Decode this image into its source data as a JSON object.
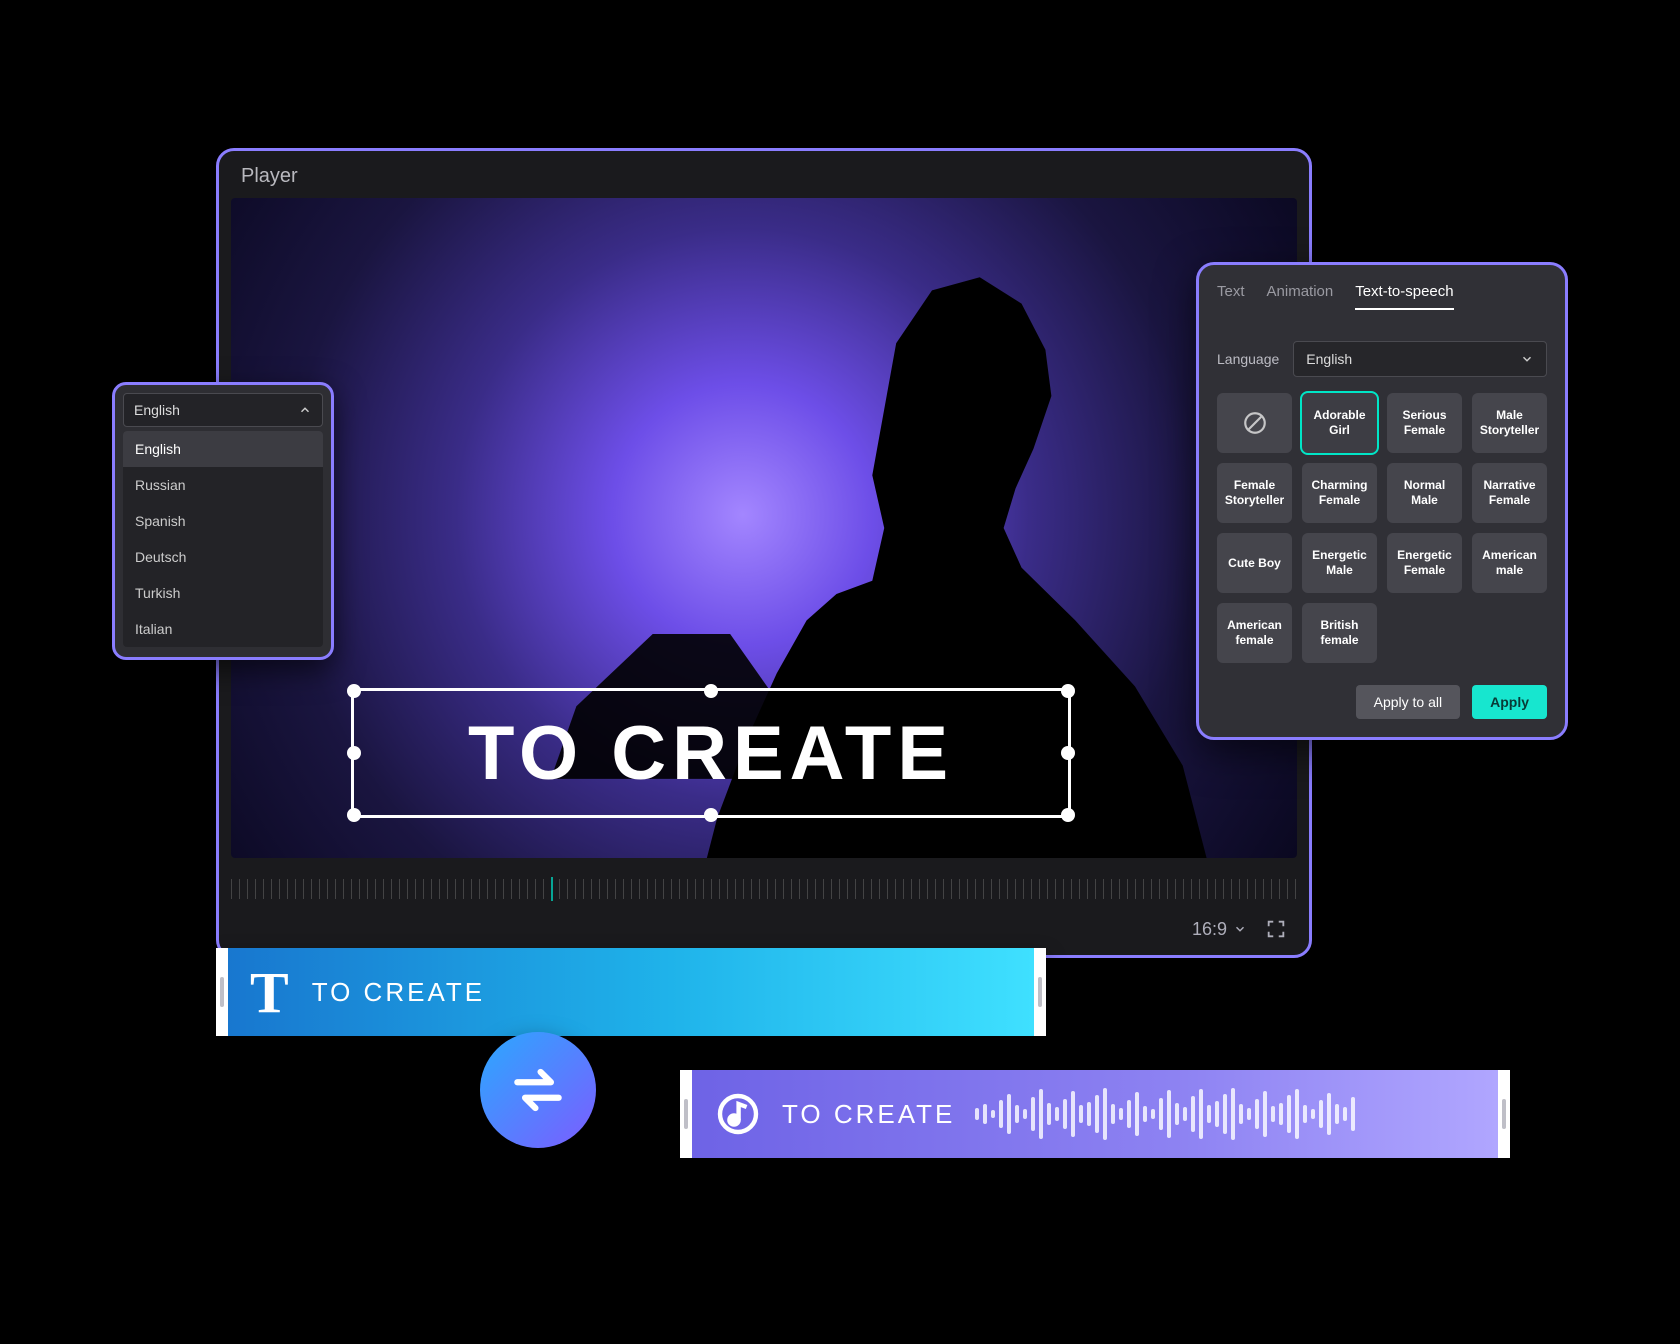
{
  "player": {
    "title": "Player",
    "overlay_text": "TO CREATE",
    "aspect_ratio": "16:9"
  },
  "language_dropdown": {
    "selected": "English",
    "options": [
      "English",
      "Russian",
      "Spanish",
      "Deutsch",
      "Turkish",
      "Italian"
    ]
  },
  "tts_panel": {
    "tabs": [
      "Text",
      "Animation",
      "Text-to-speech"
    ],
    "active_tab": "Text-to-speech",
    "language_label": "Language",
    "language_value": "English",
    "voices": [
      {
        "label": "",
        "none": true
      },
      {
        "label": "Adorable Girl",
        "selected": true
      },
      {
        "label": "Serious Female"
      },
      {
        "label": "Male Storyteller"
      },
      {
        "label": "Female Storyteller"
      },
      {
        "label": "Charming Female"
      },
      {
        "label": "Normal Male"
      },
      {
        "label": "Narrative Female"
      },
      {
        "label": "Cute Boy"
      },
      {
        "label": "Energetic Male"
      },
      {
        "label": "Energetic Female"
      },
      {
        "label": "American male"
      },
      {
        "label": "American female"
      },
      {
        "label": "British female"
      }
    ],
    "apply_all_label": "Apply to all",
    "apply_label": "Apply"
  },
  "clips": {
    "text_clip_label": "TO CREATE",
    "audio_clip_label": "TO CREATE"
  }
}
